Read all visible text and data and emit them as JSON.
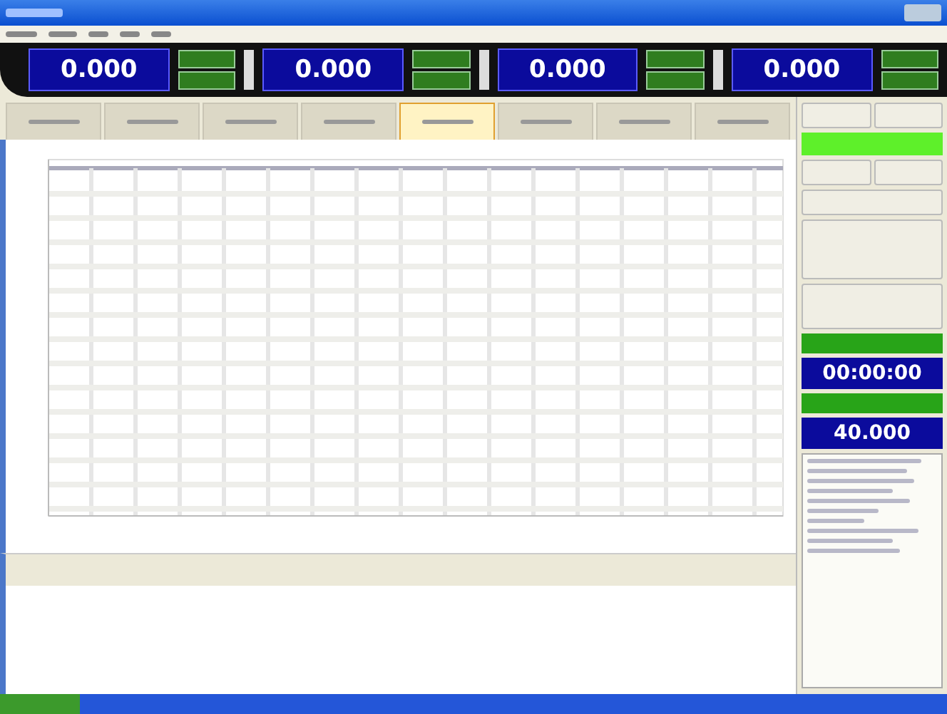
{
  "readouts": [
    {
      "value": "0.000"
    },
    {
      "value": "0.000"
    },
    {
      "value": "0.000"
    },
    {
      "value": "0.000"
    }
  ],
  "tabs": [
    {
      "selected": false
    },
    {
      "selected": false
    },
    {
      "selected": false
    },
    {
      "selected": false
    },
    {
      "selected": true
    },
    {
      "selected": false
    },
    {
      "selected": false
    },
    {
      "selected": false
    }
  ],
  "side_panel": {
    "elapsed_time": "00:00:00",
    "setpoint": "40.000"
  }
}
